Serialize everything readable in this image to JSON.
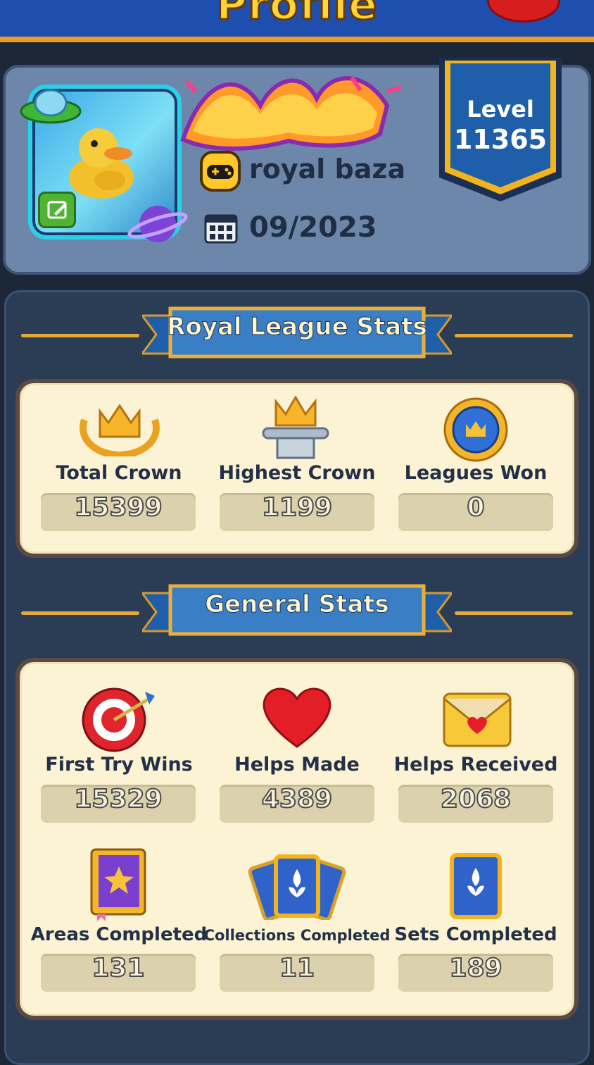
{
  "header": {
    "title": "Profile"
  },
  "profile": {
    "username": "royal baza",
    "join_date": "09/2023",
    "level_label": "Level",
    "level_value": "11365"
  },
  "royal_league": {
    "title": "Royal League Stats",
    "stats": [
      {
        "label": "Total Crown",
        "value": "15399",
        "icon": "crown-laurel-icon"
      },
      {
        "label": "Highest Crown",
        "value": "1199",
        "icon": "crown-pedestal-icon"
      },
      {
        "label": "Leagues Won",
        "value": "0",
        "icon": "crown-medal-icon"
      }
    ]
  },
  "general": {
    "title": "General Stats",
    "stats": [
      {
        "label": "First Try Wins",
        "value": "15329",
        "icon": "target-icon"
      },
      {
        "label": "Helps Made",
        "value": "4389",
        "icon": "heart-icon"
      },
      {
        "label": "Helps Received",
        "value": "2068",
        "icon": "envelope-heart-icon"
      },
      {
        "label": "Areas Completed",
        "value": "131",
        "icon": "star-book-icon"
      },
      {
        "label": "Collections Completed",
        "value": "11",
        "icon": "card-fan-icon"
      },
      {
        "label": "Sets Completed",
        "value": "189",
        "icon": "fleur-card-icon"
      }
    ]
  },
  "colors": {
    "accent_gold": "#e3a93a",
    "panel": "#2b3c55",
    "card": "#fbf3d3",
    "banner_blue": "#1f5ea8"
  }
}
